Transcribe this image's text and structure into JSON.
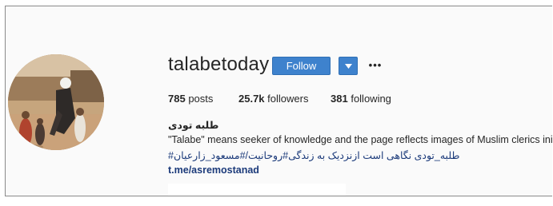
{
  "profile": {
    "username": "talabetoday",
    "follow_label": "Follow",
    "more_label": "•••",
    "full_name": "طلبه تودی",
    "bio_description": "\"Talabe\" means seeker of knowledge and the page reflects images of Muslim clerics inirar",
    "bio_hashtags": "طلبه_تودی نگاهی است ازنزدیک به زندگی#روحانیت/#مسعود_زارعیان#",
    "link": "t.me/asremostanad"
  },
  "stats": {
    "posts_count": "785",
    "posts_label": "posts",
    "followers_count": "25.7k",
    "followers_label": "followers",
    "following_count": "381",
    "following_label": "following"
  },
  "colors": {
    "accent": "#3e82cd",
    "link": "#1b3a7a",
    "text": "#262626",
    "background": "#fafafa"
  },
  "icons": {
    "dropdown": "chevron-down-icon",
    "more": "more-options-icon"
  }
}
